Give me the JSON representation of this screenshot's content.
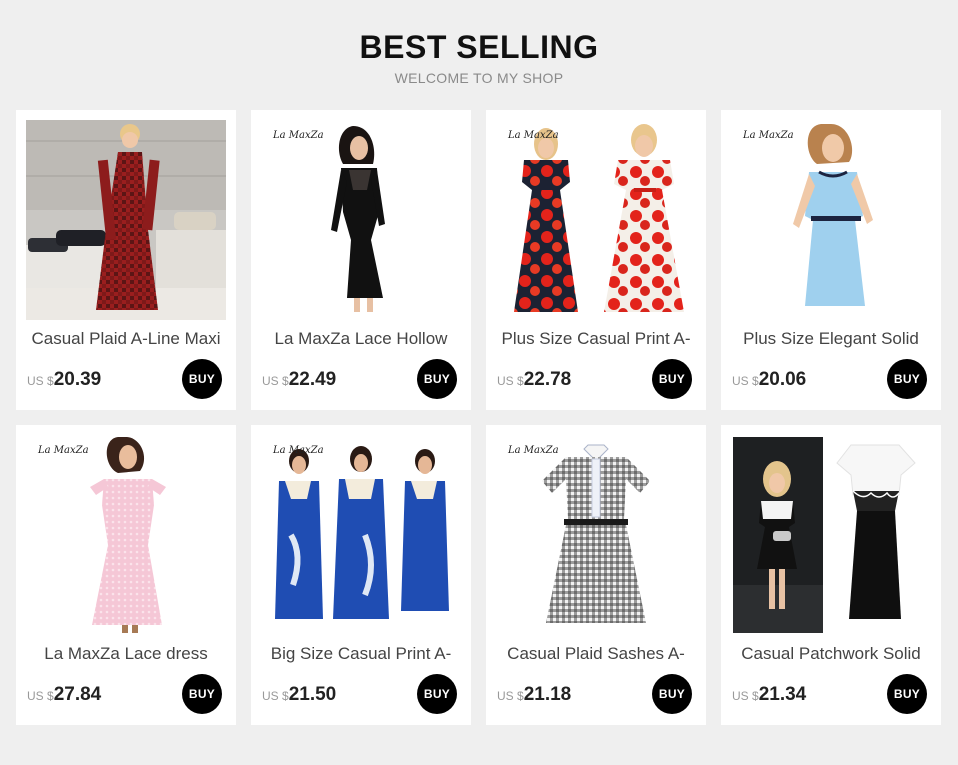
{
  "header": {
    "title": "BEST SELLING",
    "subtitle": "WELCOME TO MY SHOP"
  },
  "currency_label": "US $",
  "buy_label": "BUY",
  "products": [
    {
      "name": "Casual Plaid A-Line Maxi",
      "price": "20.39",
      "brand": "",
      "image_icon": "plaid-maxi-dress-photo"
    },
    {
      "name": "La MaxZa Lace Hollow",
      "price": "22.49",
      "brand": "La MaxZa",
      "image_icon": "black-lace-dress-photo"
    },
    {
      "name": "Plus Size Casual Print A-",
      "price": "22.78",
      "brand": "La MaxZa",
      "image_icon": "floral-print-dress-photo"
    },
    {
      "name": "Plus Size Elegant Solid",
      "price": "20.06",
      "brand": "La MaxZa",
      "image_icon": "blue-sheath-dress-photo"
    },
    {
      "name": "La MaxZa Lace dress",
      "price": "27.84",
      "brand": "La MaxZa",
      "image_icon": "pink-lace-gown-photo"
    },
    {
      "name": "Big Size Casual Print A-",
      "price": "21.50",
      "brand": "La MaxZa",
      "image_icon": "blue-print-dress-photo"
    },
    {
      "name": "Casual Plaid Sashes A-",
      "price": "21.18",
      "brand": "La MaxZa",
      "image_icon": "gingham-dress-photo"
    },
    {
      "name": "Casual Patchwork Solid",
      "price": "21.34",
      "brand": "",
      "image_icon": "patchwork-dress-photo"
    }
  ],
  "colors": {
    "background": "#efefef",
    "card": "#ffffff",
    "buy_button": "#000000"
  }
}
